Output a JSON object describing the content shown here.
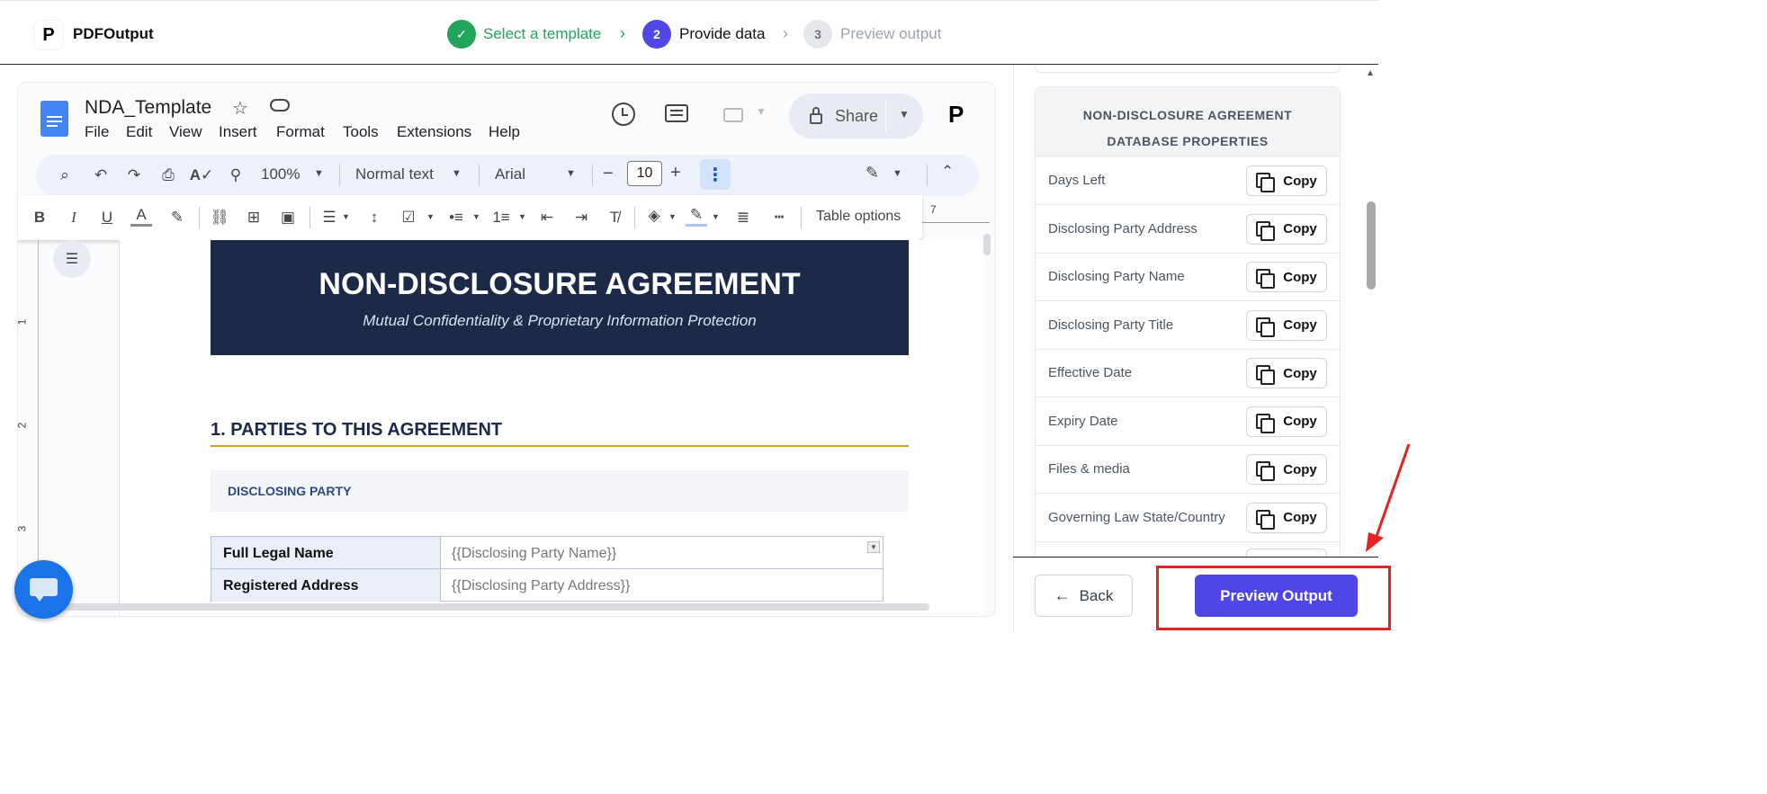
{
  "app": {
    "brand": "PDFOutput",
    "logo_letter": "P"
  },
  "steps": [
    {
      "number": "✓",
      "label": "Select a template",
      "state": "done"
    },
    {
      "number": "2",
      "label": "Provide data",
      "state": "active"
    },
    {
      "number": "3",
      "label": "Preview output",
      "state": "pending"
    }
  ],
  "colors": {
    "done": "#22a55a",
    "active": "#4f46e5",
    "pending_bg": "#e5e7eb",
    "pending_text": "#9ca3af",
    "navy": "#1c2947",
    "gold": "#c9a227",
    "annotation": "#e52222"
  },
  "docs": {
    "title": "NDA_Template",
    "menus": [
      "File",
      "Edit",
      "View",
      "Insert",
      "Format",
      "Tools",
      "Extensions",
      "Help"
    ],
    "share_label": "Share",
    "avatar_letter": "P",
    "toolbar": {
      "zoom": "100%",
      "style": "Normal text",
      "font": "Arial",
      "font_size": "10",
      "minus": "−",
      "plus": "+"
    },
    "table_options_label": "Table options",
    "ruler": {
      "top_mark": "7",
      "left_marks": [
        "1",
        "2",
        "3"
      ]
    }
  },
  "document": {
    "header_title": "NON-DISCLOSURE AGREEMENT",
    "header_subtitle": "Mutual Confidentiality & Proprietary Information Protection",
    "section_heading": "1.  PARTIES TO THIS AGREEMENT",
    "subsection_label": "DISCLOSING PARTY",
    "table": [
      {
        "label": "Full Legal Name",
        "value": "{{Disclosing Party Name}}"
      },
      {
        "label": "Registered Address",
        "value": "{{Disclosing Party Address}}"
      }
    ]
  },
  "sidebar": {
    "heading_line1": "NON-DISCLOSURE AGREEMENT",
    "heading_line2": "DATABASE PROPERTIES",
    "copy_label": "Copy",
    "properties": [
      "Days Left",
      "Disclosing Party Address",
      "Disclosing Party Name",
      "Disclosing Party Title",
      "Effective Date",
      "Expiry Date",
      "Files & media",
      "Governing Law State/Country"
    ]
  },
  "footer": {
    "back_label": "Back",
    "preview_label": "Preview Output"
  }
}
